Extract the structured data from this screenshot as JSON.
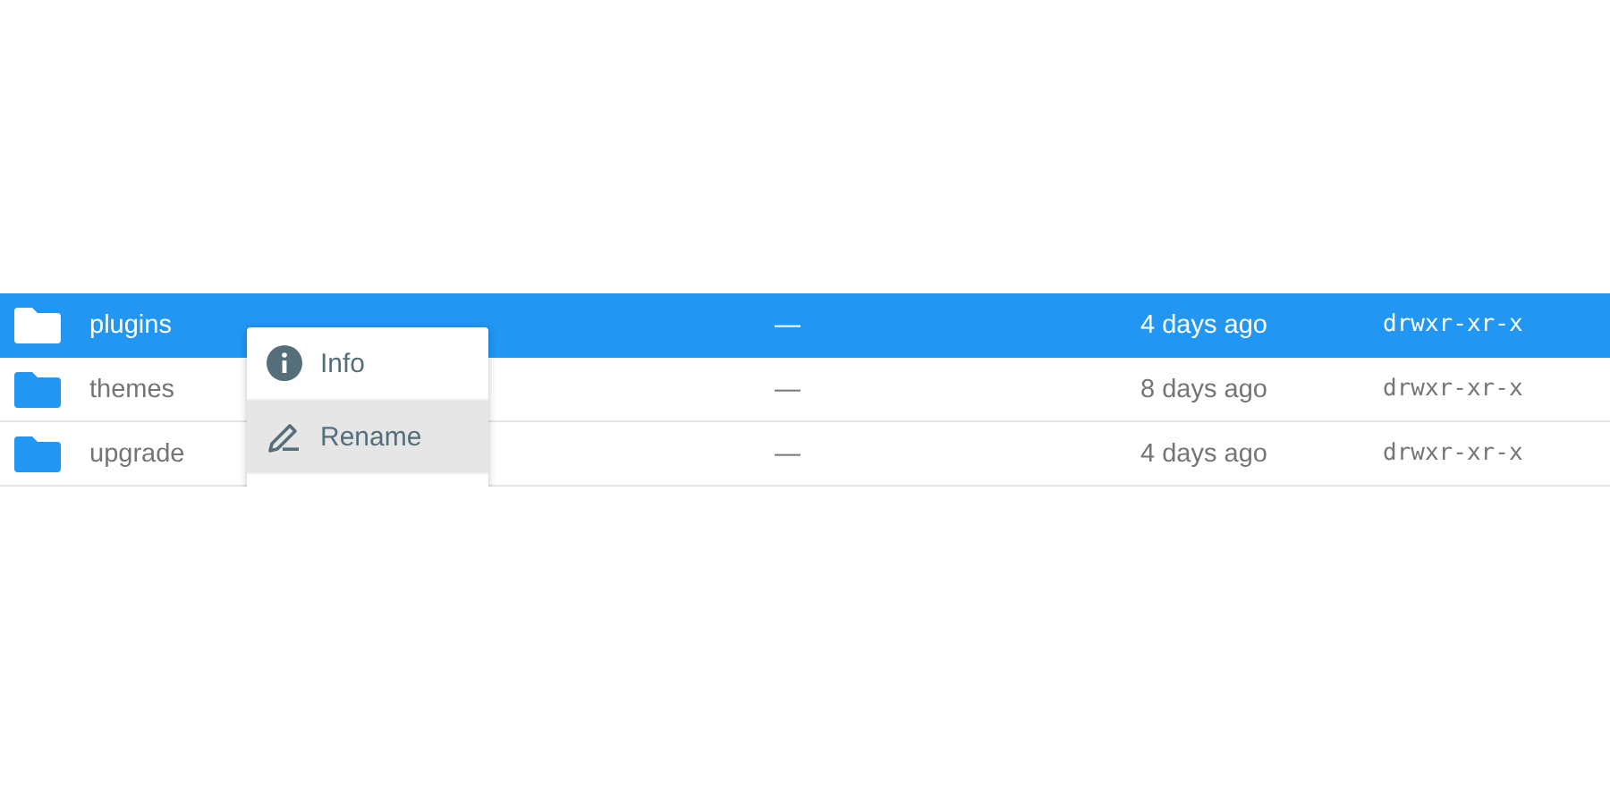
{
  "rows": [
    {
      "name": "plugins",
      "size": "—",
      "modified": "4 days ago",
      "permissions": "drwxr-xr-x",
      "selected": true
    },
    {
      "name": "themes",
      "size": "—",
      "modified": "8 days ago",
      "permissions": "drwxr-xr-x",
      "selected": false
    },
    {
      "name": "upgrade",
      "size": "—",
      "modified": "4 days ago",
      "permissions": "drwxr-xr-x",
      "selected": false
    }
  ],
  "context_menu": {
    "items": [
      {
        "label": "Info",
        "kind": "info",
        "selected": false
      },
      {
        "label": "Rename",
        "kind": "rename",
        "selected": true
      }
    ]
  }
}
